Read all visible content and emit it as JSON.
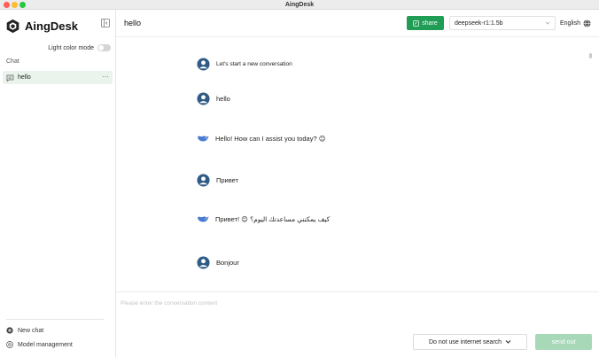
{
  "window": {
    "title": "AingDesk"
  },
  "sidebar": {
    "brand": "AingDesk",
    "light_mode_label": "Light color mode",
    "section_label": "Chat",
    "chats": [
      {
        "label": "hello",
        "more": "···"
      }
    ],
    "new_chat_label": "New chat",
    "model_management_label": "Model management"
  },
  "header": {
    "title": "hello",
    "share_label": "share",
    "model_value": "deepseek-r1:1.5b",
    "language_label": "English"
  },
  "messages": [
    {
      "role": "system",
      "text": "Let's start a new conversation"
    },
    {
      "role": "user",
      "text": "hello"
    },
    {
      "role": "assistant",
      "text": "Hello! How can I assist you today? 😊"
    },
    {
      "role": "user",
      "text": "Привет"
    },
    {
      "role": "assistant",
      "text": "Привет! 😊 كيف يمكنني مساعدتك اليوم؟"
    },
    {
      "role": "user",
      "text": "Bonjour"
    }
  ],
  "composer": {
    "placeholder": "Please enter the conversation content",
    "search_mode": "Do not use internet search",
    "send_label": "send out"
  },
  "colors": {
    "accent": "#1f9d55",
    "send_disabled": "#a7d8b8",
    "active_chat_bg": "#eaf3ec",
    "avatar": "#2f5b85",
    "bot_icon": "#4a7bd0"
  },
  "icons": {
    "brand": "aingdesk-logo-icon",
    "collapse": "sidebar-collapse-icon",
    "chat": "chat-bubble-icon",
    "new_chat": "plus-circle-icon",
    "models": "gear-circle-icon",
    "share": "share-icon",
    "chevron": "chevron-down-icon",
    "language": "globe-icon",
    "user": "user-avatar-icon",
    "assistant": "whale-icon"
  }
}
